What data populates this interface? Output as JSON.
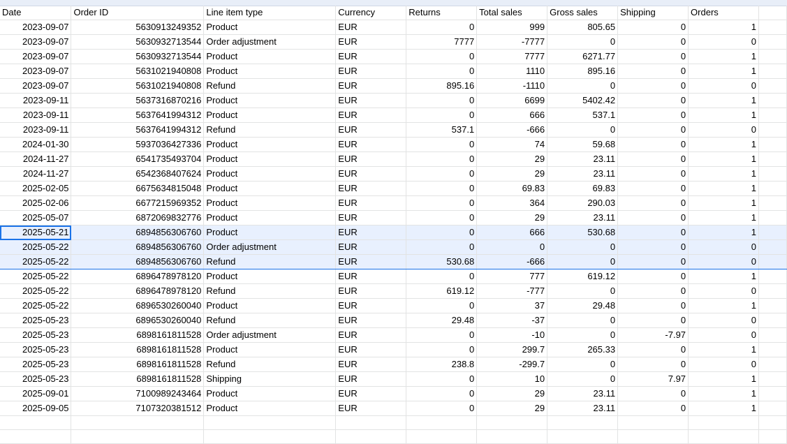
{
  "headers": [
    "Date",
    "Order ID",
    "Line item type",
    "Currency",
    "Returns",
    "Total sales",
    "Gross sales",
    "Shipping",
    "Orders"
  ],
  "rows": [
    [
      "2023-09-07",
      "5630913249352",
      "Product",
      "EUR",
      "0",
      "999",
      "805.65",
      "0",
      "1"
    ],
    [
      "2023-09-07",
      "5630932713544",
      "Order adjustment",
      "EUR",
      "7777",
      "-7777",
      "0",
      "0",
      "0"
    ],
    [
      "2023-09-07",
      "5630932713544",
      "Product",
      "EUR",
      "0",
      "7777",
      "6271.77",
      "0",
      "1"
    ],
    [
      "2023-09-07",
      "5631021940808",
      "Product",
      "EUR",
      "0",
      "1110",
      "895.16",
      "0",
      "1"
    ],
    [
      "2023-09-07",
      "5631021940808",
      "Refund",
      "EUR",
      "895.16",
      "-1110",
      "0",
      "0",
      "0"
    ],
    [
      "2023-09-11",
      "5637316870216",
      "Product",
      "EUR",
      "0",
      "6699",
      "5402.42",
      "0",
      "1"
    ],
    [
      "2023-09-11",
      "5637641994312",
      "Product",
      "EUR",
      "0",
      "666",
      "537.1",
      "0",
      "1"
    ],
    [
      "2023-09-11",
      "5637641994312",
      "Refund",
      "EUR",
      "537.1",
      "-666",
      "0",
      "0",
      "0"
    ],
    [
      "2024-01-30",
      "5937036427336",
      "Product",
      "EUR",
      "0",
      "74",
      "59.68",
      "0",
      "1"
    ],
    [
      "2024-11-27",
      "6541735493704",
      "Product",
      "EUR",
      "0",
      "29",
      "23.11",
      "0",
      "1"
    ],
    [
      "2024-11-27",
      "6542368407624",
      "Product",
      "EUR",
      "0",
      "29",
      "23.11",
      "0",
      "1"
    ],
    [
      "2025-02-05",
      "6675634815048",
      "Product",
      "EUR",
      "0",
      "69.83",
      "69.83",
      "0",
      "1"
    ],
    [
      "2025-02-06",
      "6677215969352",
      "Product",
      "EUR",
      "0",
      "364",
      "290.03",
      "0",
      "1"
    ],
    [
      "2025-05-07",
      "6872069832776",
      "Product",
      "EUR",
      "0",
      "29",
      "23.11",
      "0",
      "1"
    ],
    [
      "2025-05-21",
      "6894856306760",
      "Product",
      "EUR",
      "0",
      "666",
      "530.68",
      "0",
      "1"
    ],
    [
      "2025-05-22",
      "6894856306760",
      "Order adjustment",
      "EUR",
      "0",
      "0",
      "0",
      "0",
      "0"
    ],
    [
      "2025-05-22",
      "6894856306760",
      "Refund",
      "EUR",
      "530.68",
      "-666",
      "0",
      "0",
      "0"
    ],
    [
      "2025-05-22",
      "6896478978120",
      "Product",
      "EUR",
      "0",
      "777",
      "619.12",
      "0",
      "1"
    ],
    [
      "2025-05-22",
      "6896478978120",
      "Refund",
      "EUR",
      "619.12",
      "-777",
      "0",
      "0",
      "0"
    ],
    [
      "2025-05-22",
      "6896530260040",
      "Product",
      "EUR",
      "0",
      "37",
      "29.48",
      "0",
      "1"
    ],
    [
      "2025-05-23",
      "6896530260040",
      "Refund",
      "EUR",
      "29.48",
      "-37",
      "0",
      "0",
      "0"
    ],
    [
      "2025-05-23",
      "6898161811528",
      "Order adjustment",
      "EUR",
      "0",
      "-10",
      "0",
      "-7.97",
      "0"
    ],
    [
      "2025-05-23",
      "6898161811528",
      "Product",
      "EUR",
      "0",
      "299.7",
      "265.33",
      "0",
      "1"
    ],
    [
      "2025-05-23",
      "6898161811528",
      "Refund",
      "EUR",
      "238.8",
      "-299.7",
      "0",
      "0",
      "0"
    ],
    [
      "2025-05-23",
      "6898161811528",
      "Shipping",
      "EUR",
      "0",
      "10",
      "0",
      "7.97",
      "1"
    ],
    [
      "2025-09-01",
      "7100989243464",
      "Product",
      "EUR",
      "0",
      "29",
      "23.11",
      "0",
      "1"
    ],
    [
      "2025-09-05",
      "7107320381512",
      "Product",
      "EUR",
      "0",
      "29",
      "23.11",
      "0",
      "1"
    ]
  ]
}
